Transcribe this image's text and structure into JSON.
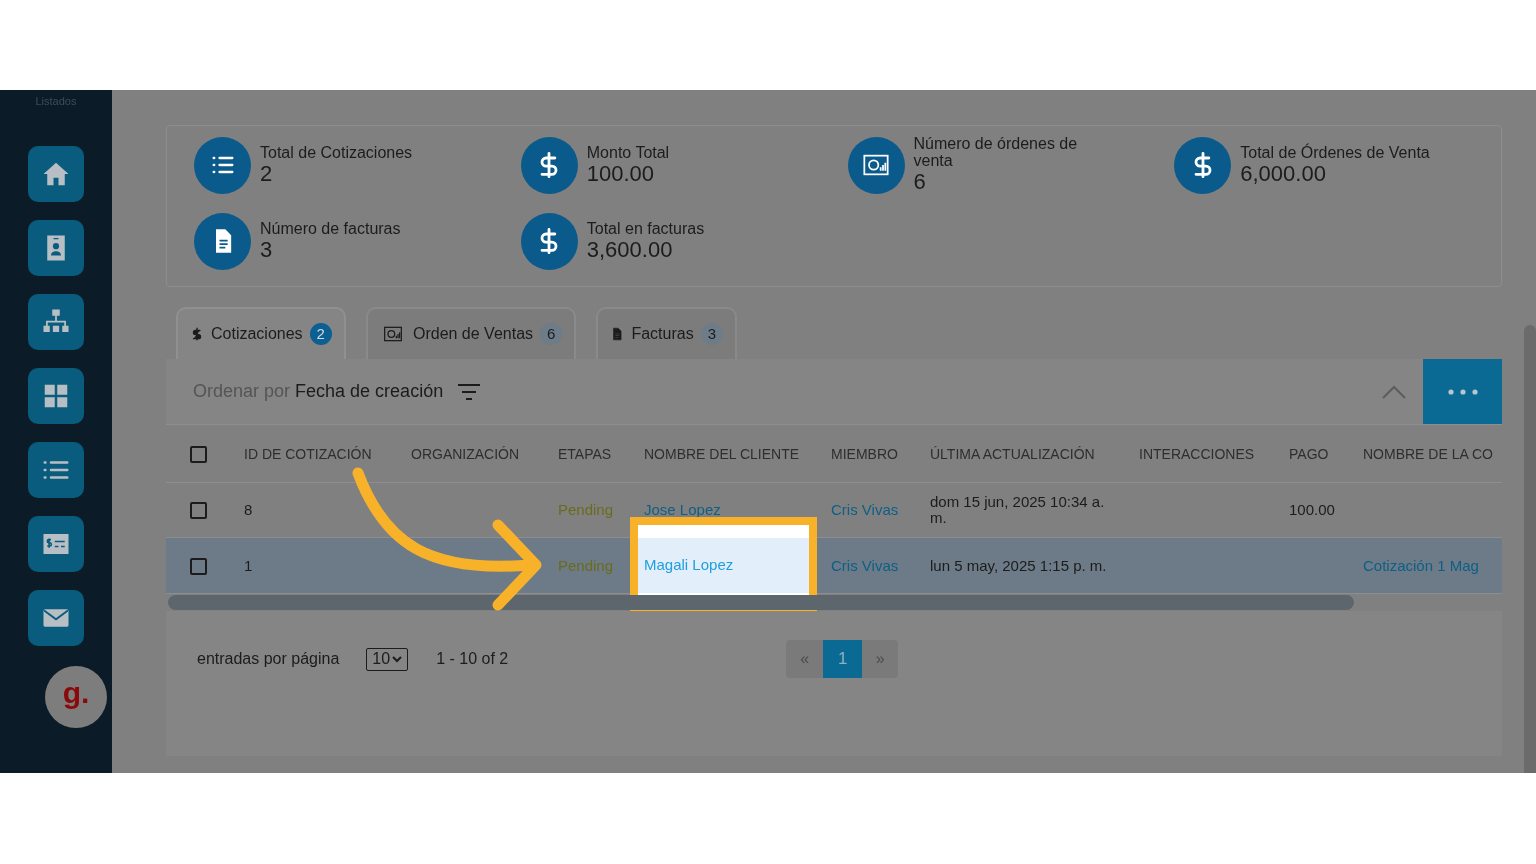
{
  "sidebar": {
    "section_label": "Listados",
    "logo": "g."
  },
  "stats": [
    {
      "kind": "list",
      "label": "Total de Cotizaciones",
      "value": "2"
    },
    {
      "kind": "dollar",
      "label": "Monto Total",
      "value": "100.00"
    },
    {
      "kind": "chart",
      "label": "Número de órdenes de venta",
      "value": "6"
    },
    {
      "kind": "dollar",
      "label": "Total de Órdenes de Venta",
      "value": "6,000.00"
    },
    {
      "kind": "invoice",
      "label": "Número de facturas",
      "value": "3"
    },
    {
      "kind": "dollar",
      "label": "Total en facturas",
      "value": "3,600.00"
    }
  ],
  "tabs": [
    {
      "kind": "dollar",
      "label": "Cotizaciones",
      "count": "2",
      "selected": true
    },
    {
      "kind": "chart",
      "label": "Orden de Ventas",
      "count": "6",
      "selected": false
    },
    {
      "kind": "invoice",
      "label": "Facturas",
      "count": "3",
      "selected": false
    }
  ],
  "sort": {
    "prefix": "Ordenar por",
    "value": "Fecha de creación"
  },
  "table": {
    "select_all": {
      "checked": false
    },
    "columns": [
      "ID DE COTIZACIÓN",
      "ORGANIZACIÓN",
      "ETAPAS",
      "NOMBRE DEL CLIENTE",
      "MIEMBRO",
      "ÚLTIMA ACTUALIZACIÓN",
      "INTERACCIONES",
      "PAGO",
      "NOMBRE DE LA CO"
    ],
    "rows": [
      {
        "checked": false,
        "selected": false,
        "highlighted": false,
        "id": "8",
        "stage": "Pending",
        "client": "Jose Lopez",
        "member": "Cris Vivas",
        "updated": "dom 15 jun, 2025 10:34 a. m.",
        "payment": "100.00"
      },
      {
        "checked": false,
        "selected": true,
        "highlighted": true,
        "id": "1",
        "stage": "Pending",
        "client": "Magali Lopez",
        "member": "Cris Vivas",
        "updated": "lun 5 may, 2025 1:15 p. m.",
        "quote_name": "Cotización 1 Mag"
      }
    ]
  },
  "pagination": {
    "label": "entradas por página",
    "per_page": "10",
    "range": "1 - 10 of 2",
    "prev": "«",
    "page": "1",
    "next": "»"
  }
}
